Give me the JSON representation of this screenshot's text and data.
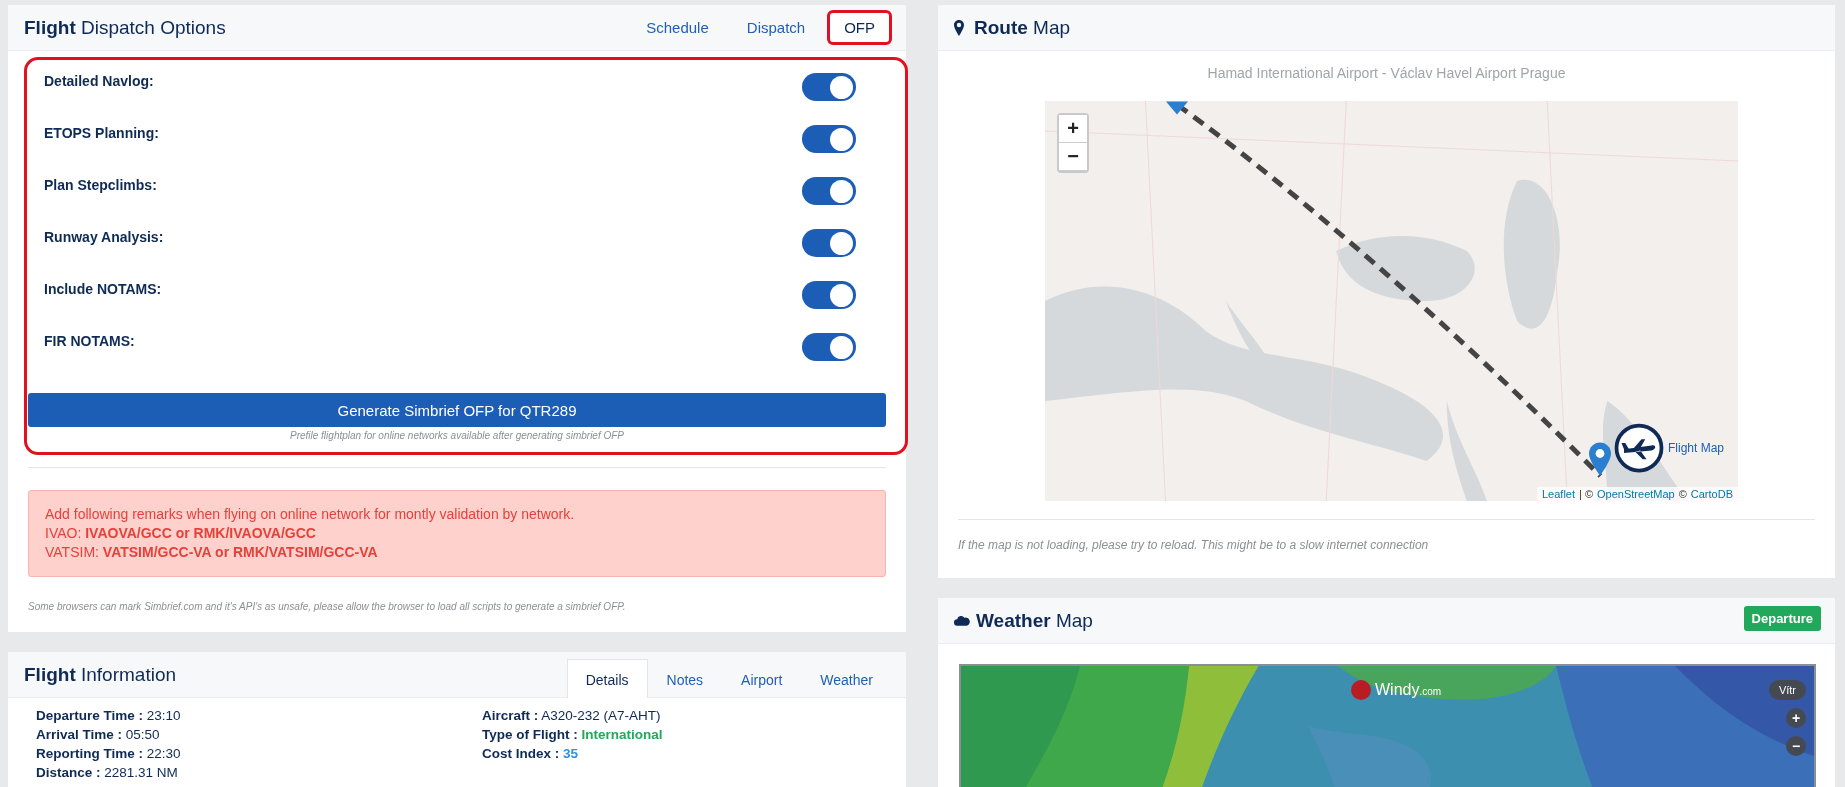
{
  "dispatch": {
    "title_bold": "Flight",
    "title_rest": "Dispatch Options",
    "tabs": [
      {
        "label": "Schedule",
        "selected": false,
        "highlighted": false
      },
      {
        "label": "Dispatch",
        "selected": false,
        "highlighted": false
      },
      {
        "label": "OFP",
        "selected": true,
        "highlighted": true
      }
    ],
    "options_highlighted": true,
    "options": [
      {
        "label": "Detailed Navlog:",
        "on": true
      },
      {
        "label": "ETOPS Planning:",
        "on": true
      },
      {
        "label": "Plan Stepclimbs:",
        "on": true
      },
      {
        "label": "Runway Analysis:",
        "on": true
      },
      {
        "label": "Include NOTAMS:",
        "on": true
      },
      {
        "label": "FIR NOTAMS:",
        "on": true
      }
    ],
    "generate_button": "Generate Simbrief OFP for QTR289",
    "generate_note": "Prefile flightplan for online networks available after generating simbrief OFP",
    "alert_lines": [
      "Add following remarks when flying on online network for montly validation by network.",
      "IVAO: **IVAOVA/GCC or RMK/IVAOVA/GCC**",
      "VATSIM: **VATSIM/GCC-VA or RMK/VATSIM/GCC-VA**"
    ],
    "browser_note": "Some browsers can mark Simbrief.com and it's API's as unsafe, please allow the browser to load all scripts to generate a simbrief OFP."
  },
  "info": {
    "title_bold": "Flight",
    "title_rest": "Information",
    "tabs": [
      {
        "label": "Details",
        "selected": true
      },
      {
        "label": "Notes",
        "selected": false
      },
      {
        "label": "Airport",
        "selected": false
      },
      {
        "label": "Weather",
        "selected": false
      }
    ],
    "left": [
      {
        "label": "Departure Time :",
        "value": "23:10"
      },
      {
        "label": "Arrival Time :",
        "value": "05:50"
      },
      {
        "label": "Reporting Time :",
        "value": "22:30"
      },
      {
        "label": "Distance :",
        "value": "2281.31 NM"
      }
    ],
    "right": [
      {
        "label": "Aircraft :",
        "value": "A320-232 (A7-AHT)"
      },
      {
        "label": "Type of Flight :",
        "value": "International",
        "kind": "status"
      },
      {
        "label": "Cost Index :",
        "value": "35",
        "kind": "number"
      }
    ]
  },
  "route_map": {
    "title_bold": "Route",
    "title_rest": "Map",
    "subtitle": "Hamad International Airport - Václav Havel Airport Prague",
    "zoom_in": "+",
    "zoom_out": "−",
    "flight_map_label": "Flight Map",
    "attribution": [
      {
        "text": "Leaflet",
        "kind": "link"
      },
      {
        "text": "| ©",
        "kind": "text"
      },
      {
        "text": "OpenStreetMap",
        "kind": "link"
      },
      {
        "text": "©",
        "kind": "text"
      },
      {
        "text": "CartoDB",
        "kind": "link"
      }
    ],
    "note": "If the map is not loading, please try to reload. This might be to a slow internet connection"
  },
  "weather_map": {
    "title_bold": "Weather",
    "title_rest": "Map",
    "badge": "Departure",
    "logo_text": "Windy",
    "logo_suffix": ".com",
    "layer_label": "Vítr",
    "zoom_in": "+",
    "zoom_out": "−"
  }
}
